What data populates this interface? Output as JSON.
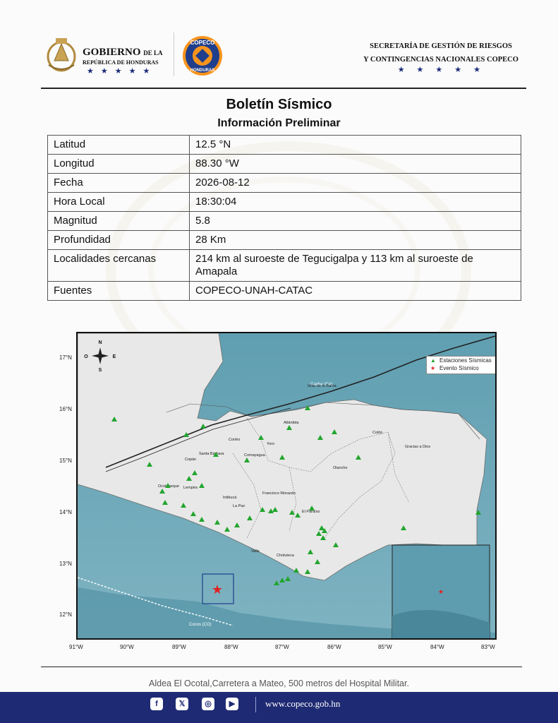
{
  "header": {
    "gov_title": "GOBIERNO",
    "gov_de_la": "DE LA",
    "gov_sub": "REPÚBLICA DE HONDURAS",
    "stars": "★★★★★",
    "copeco_top": "COPECO",
    "copeco_bottom": "HONDURAS",
    "secretaria_line1": "SECRETARÍA DE GESTIÓN DE RIESGOS",
    "secretaria_line2": "Y CONTINGENCIAS NACIONALES COPECO",
    "sec_stars": "★★★★★"
  },
  "title": "Boletín Sísmico",
  "subtitle": "Información Preliminar",
  "rows": [
    {
      "key": "Latitud",
      "value": "12.5 °N"
    },
    {
      "key": "Longitud",
      "value": "88.30 °W"
    },
    {
      "key": "Fecha",
      "value": "2026-08-12"
    },
    {
      "key": "Hora Local",
      "value": "18:30:04"
    },
    {
      "key": "Magnitud",
      "value": "5.8"
    },
    {
      "key": "Profundidad",
      "value": "28 Km"
    },
    {
      "key": "Localidades cercanas",
      "value": "214 km al suroeste de Tegucigalpa y 113 km al suroeste de Amapala"
    },
    {
      "key": "Fuentes",
      "value": "COPECO-UNAH-CATAC"
    }
  ],
  "map": {
    "lat_labels": [
      "17°N",
      "16°N",
      "15°N",
      "14°N",
      "13°N",
      "12°N"
    ],
    "lon_labels": [
      "91°W",
      "90°W",
      "89°W",
      "88°W",
      "87°W",
      "86°W",
      "85°W",
      "84°W",
      "83°W"
    ],
    "legend_stations": "Estaciones Sísmicas",
    "legend_event": "Evento Sísmico",
    "compass": {
      "n": "N",
      "s": "S",
      "e": "E",
      "o": "O"
    },
    "places": [
      "Islas de la Bahía",
      "Atlántida",
      "Colón",
      "Gracias a Dios",
      "Cortés",
      "Yoro",
      "Santa Bárbara",
      "Copán",
      "Comayagua",
      "Olancho",
      "Ocotepeque",
      "Lempira",
      "Francisco Morazán",
      "Intibucá",
      "La Paz",
      "El Paraíso",
      "Valle",
      "Choluteca"
    ],
    "fault_label_north": "Caribe (CA)",
    "fault_label_south": "Cocos (CO)",
    "colors": {
      "sea": "#6aa4b4",
      "land": "#e9e9e9",
      "station": "#22a52e",
      "event": "#e02020"
    }
  },
  "footer": {
    "address": "Aldea El Ocotal,Carretera a Mateo, 500 metros del Hospital Militar.",
    "website": "www.copeco.gob.hn",
    "social": [
      "facebook-icon",
      "x-icon",
      "instagram-icon",
      "youtube-icon"
    ]
  }
}
